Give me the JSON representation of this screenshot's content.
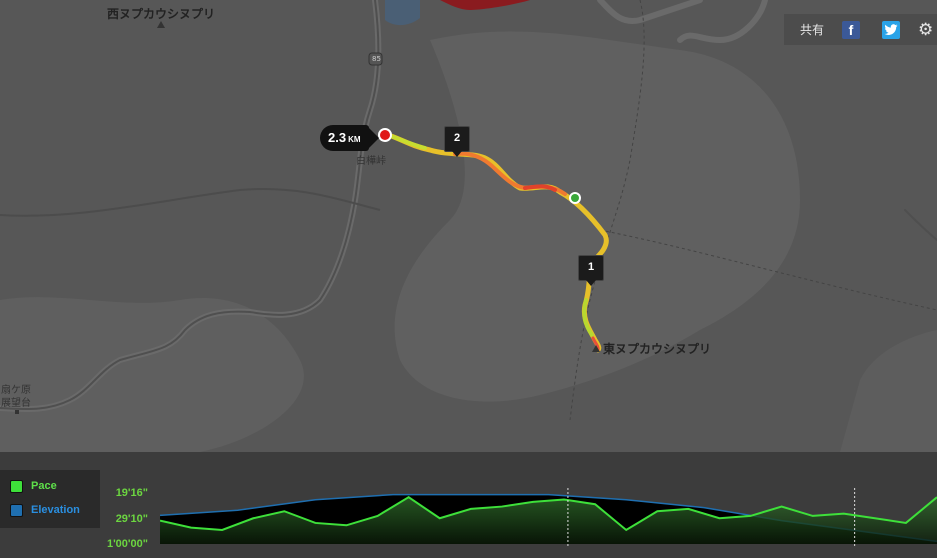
{
  "map": {
    "labels": {
      "west_peak": "西ヌプカウシヌプリ",
      "east_peak": "東ヌプカウシヌプリ",
      "pass": "白樺峠",
      "lookout_1": "扇ケ原",
      "lookout_2": "展望台",
      "route_number": "85"
    },
    "distance_badge": {
      "value": "2.3",
      "unit": "KM"
    },
    "split_markers": [
      "1",
      "2"
    ],
    "route_colors": [
      "#d8d82a",
      "#f0b020",
      "#f08030",
      "#e04a20"
    ]
  },
  "share": {
    "label": "共有",
    "facebook_glyph": "f",
    "facebook_icon": "facebook-icon",
    "twitter_icon": "twitter-icon",
    "settings_icon": "gear-icon"
  },
  "legend": {
    "pace_label": "Pace",
    "elevation_label": "Elevation",
    "pace_color": "#3ee03a",
    "elevation_color": "#1f6fb0",
    "pace_text_color": "#5ee04a",
    "elevation_text_color": "#2a8fe0"
  },
  "chart_data": {
    "type": "area",
    "y_ticks": [
      "19'16\"",
      "29'10\"",
      "1'00'00\""
    ],
    "grid": false,
    "series": [
      {
        "name": "Pace",
        "x": [
          0,
          4,
          8,
          12,
          16,
          20,
          24,
          28,
          32,
          36,
          40,
          44,
          48,
          52,
          56,
          60,
          64,
          68,
          72,
          76,
          80,
          84,
          88,
          92,
          96,
          100
        ],
        "values": [
          0.5,
          0.35,
          0.3,
          0.55,
          0.7,
          0.45,
          0.4,
          0.6,
          1.0,
          0.55,
          0.75,
          0.8,
          0.9,
          0.95,
          0.85,
          0.3,
          0.7,
          0.75,
          0.55,
          0.6,
          0.8,
          0.6,
          0.65,
          0.55,
          0.45,
          1.0
        ]
      },
      {
        "name": "Elevation",
        "x": [
          0,
          10,
          20,
          30,
          40,
          50,
          60,
          70,
          80,
          90,
          100
        ],
        "values": [
          0.45,
          0.35,
          0.15,
          0.05,
          0.05,
          0.05,
          0.15,
          0.3,
          0.55,
          0.75,
          0.95
        ]
      }
    ]
  }
}
